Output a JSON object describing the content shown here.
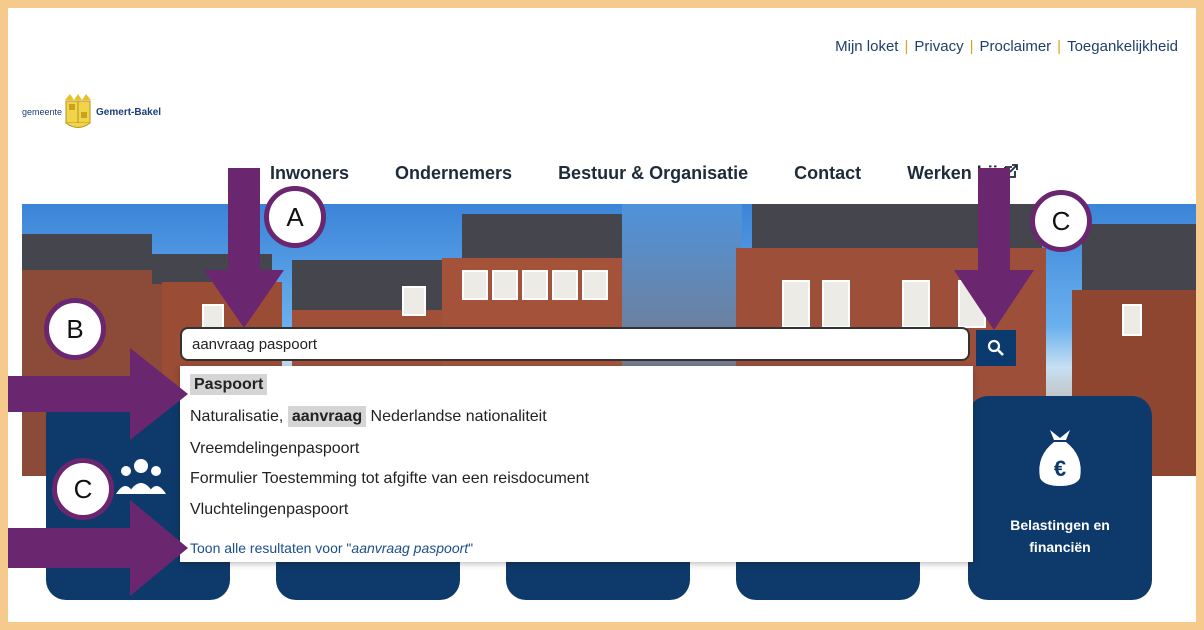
{
  "top_links": [
    "Mijn loket",
    "Privacy",
    "Proclaimer",
    "Toegankelijkheid"
  ],
  "logo": {
    "prefix": "gemeente",
    "name": "Gemert-Bakel"
  },
  "nav": [
    "Inwoners",
    "Ondernemers",
    "Bestuur & Organisatie",
    "Contact",
    "Werken bij"
  ],
  "search": {
    "value": "aanvraag paspoort"
  },
  "suggestions": [
    {
      "text": "Paspoort"
    },
    {
      "before": "Naturalisatie, ",
      "highlight": "aanvraag",
      "after": " Nederlandse nationaliteit"
    },
    {
      "text": "Vreemdelingenpaspoort"
    },
    {
      "text": "Formulier Toestemming tot afgifte van een reisdocument"
    },
    {
      "text": "Vluchtelingenpaspoort"
    }
  ],
  "show_all": {
    "prefix": "Toon alle resultaten voor \"",
    "query": "aanvraag paspoort",
    "suffix": "\""
  },
  "tiles": {
    "last_label": [
      "Belastingen en",
      "financiën"
    ]
  },
  "annotations": {
    "A": "A",
    "B": "B",
    "C_top": "C",
    "C_bottom": "C"
  },
  "colors": {
    "navy": "#0e3a6b",
    "purple": "#6b2670",
    "frame": "#f6c98c"
  }
}
